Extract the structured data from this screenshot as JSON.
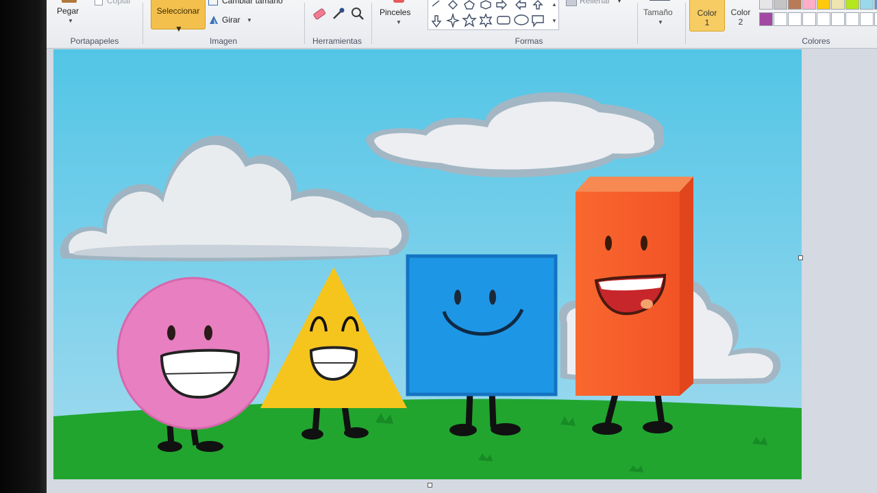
{
  "ribbon": {
    "clipboard": {
      "paste_label": "Pegar",
      "copy_label": "Copiar",
      "group_label": "Portapapeles"
    },
    "image": {
      "select_label": "Seleccionar",
      "resize_label": "Cambiar tamaño",
      "rotate_label": "Girar",
      "group_label": "Imagen"
    },
    "tools": {
      "group_label": "Herramientas",
      "icons": [
        "eraser-icon",
        "color-picker-icon",
        "magnifier-icon"
      ]
    },
    "brushes": {
      "label": "Pinceles"
    },
    "shapes": {
      "group_label": "Formas",
      "fill_label": "Rellenar"
    },
    "size": {
      "label": "Tamaño"
    },
    "colors": {
      "color1_label": "Color",
      "color1_num": "1",
      "color2_label": "Color",
      "color2_num": "2",
      "group_label": "Colores",
      "palette_row1": [
        "#e6e6e6",
        "#c3c3c3",
        "#b97a57",
        "#ffaec9",
        "#ffc90e",
        "#efe4b0",
        "#b5e61d",
        "#99d9ea",
        "#7092be"
      ],
      "palette_row2": [
        "#a349a4",
        "#ffffff",
        "#ffffff",
        "#ffffff",
        "#ffffff",
        "#ffffff",
        "#ffffff",
        "#ffffff",
        "#ffffff"
      ]
    }
  },
  "canvas": {
    "sky_color": "#7fcde6",
    "grass_color": "#21a52f",
    "characters": [
      {
        "name": "circle",
        "color": "#e77fc1"
      },
      {
        "name": "triangle",
        "color": "#f5c51e"
      },
      {
        "name": "square",
        "color": "#1e96e6"
      },
      {
        "name": "rectangle-prism",
        "color": "#f7622b"
      }
    ]
  }
}
